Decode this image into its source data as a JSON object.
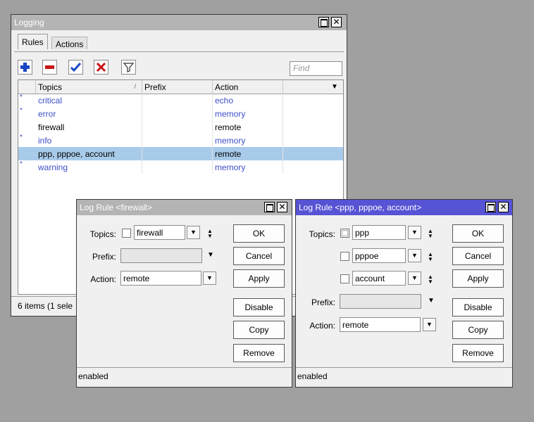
{
  "logging": {
    "title": "Logging",
    "tabs": [
      "Rules",
      "Actions"
    ],
    "find_placeholder": "Find",
    "columns": [
      "Topics",
      "Prefix",
      "Action"
    ],
    "rows": [
      {
        "topics": "critical",
        "prefix": "",
        "action": "echo",
        "default": true
      },
      {
        "topics": "error",
        "prefix": "",
        "action": "memory",
        "default": true
      },
      {
        "topics": "firewall",
        "prefix": "",
        "action": "remote",
        "default": false
      },
      {
        "topics": "info",
        "prefix": "",
        "action": "memory",
        "default": true
      },
      {
        "topics": "ppp, pppoe, account",
        "prefix": "",
        "action": "remote",
        "default": false,
        "selected": true
      },
      {
        "topics": "warning",
        "prefix": "",
        "action": "memory",
        "default": true
      }
    ],
    "status": "6 items (1 sele"
  },
  "rule_firewall": {
    "title": "Log Rule <firewall>",
    "topics_label": "Topics:",
    "topics_value": "firewall",
    "prefix_label": "Prefix:",
    "prefix_value": "",
    "action_label": "Action:",
    "action_value": "remote",
    "buttons": [
      "OK",
      "Cancel",
      "Apply",
      "Disable",
      "Copy",
      "Remove"
    ],
    "status": "enabled"
  },
  "rule_ppp": {
    "title": "Log Rule <ppp, pppoe, account>",
    "topics_label": "Topics:",
    "topics_values": [
      "ppp",
      "pppoe",
      "account"
    ],
    "prefix_label": "Prefix:",
    "prefix_value": "",
    "action_label": "Action:",
    "action_value": "remote",
    "buttons": [
      "OK",
      "Cancel",
      "Apply",
      "Disable",
      "Copy",
      "Remove"
    ],
    "status": "enabled"
  },
  "icons": {
    "default_marker": "*",
    "close": "✕",
    "dropdown": "▼",
    "sort": "/"
  },
  "colors": {
    "active_title": "#5653d5",
    "inactive_title": "#b4b4b4",
    "default_rule_text": "#3c4fc9",
    "selected_row": "#a8cbea"
  }
}
